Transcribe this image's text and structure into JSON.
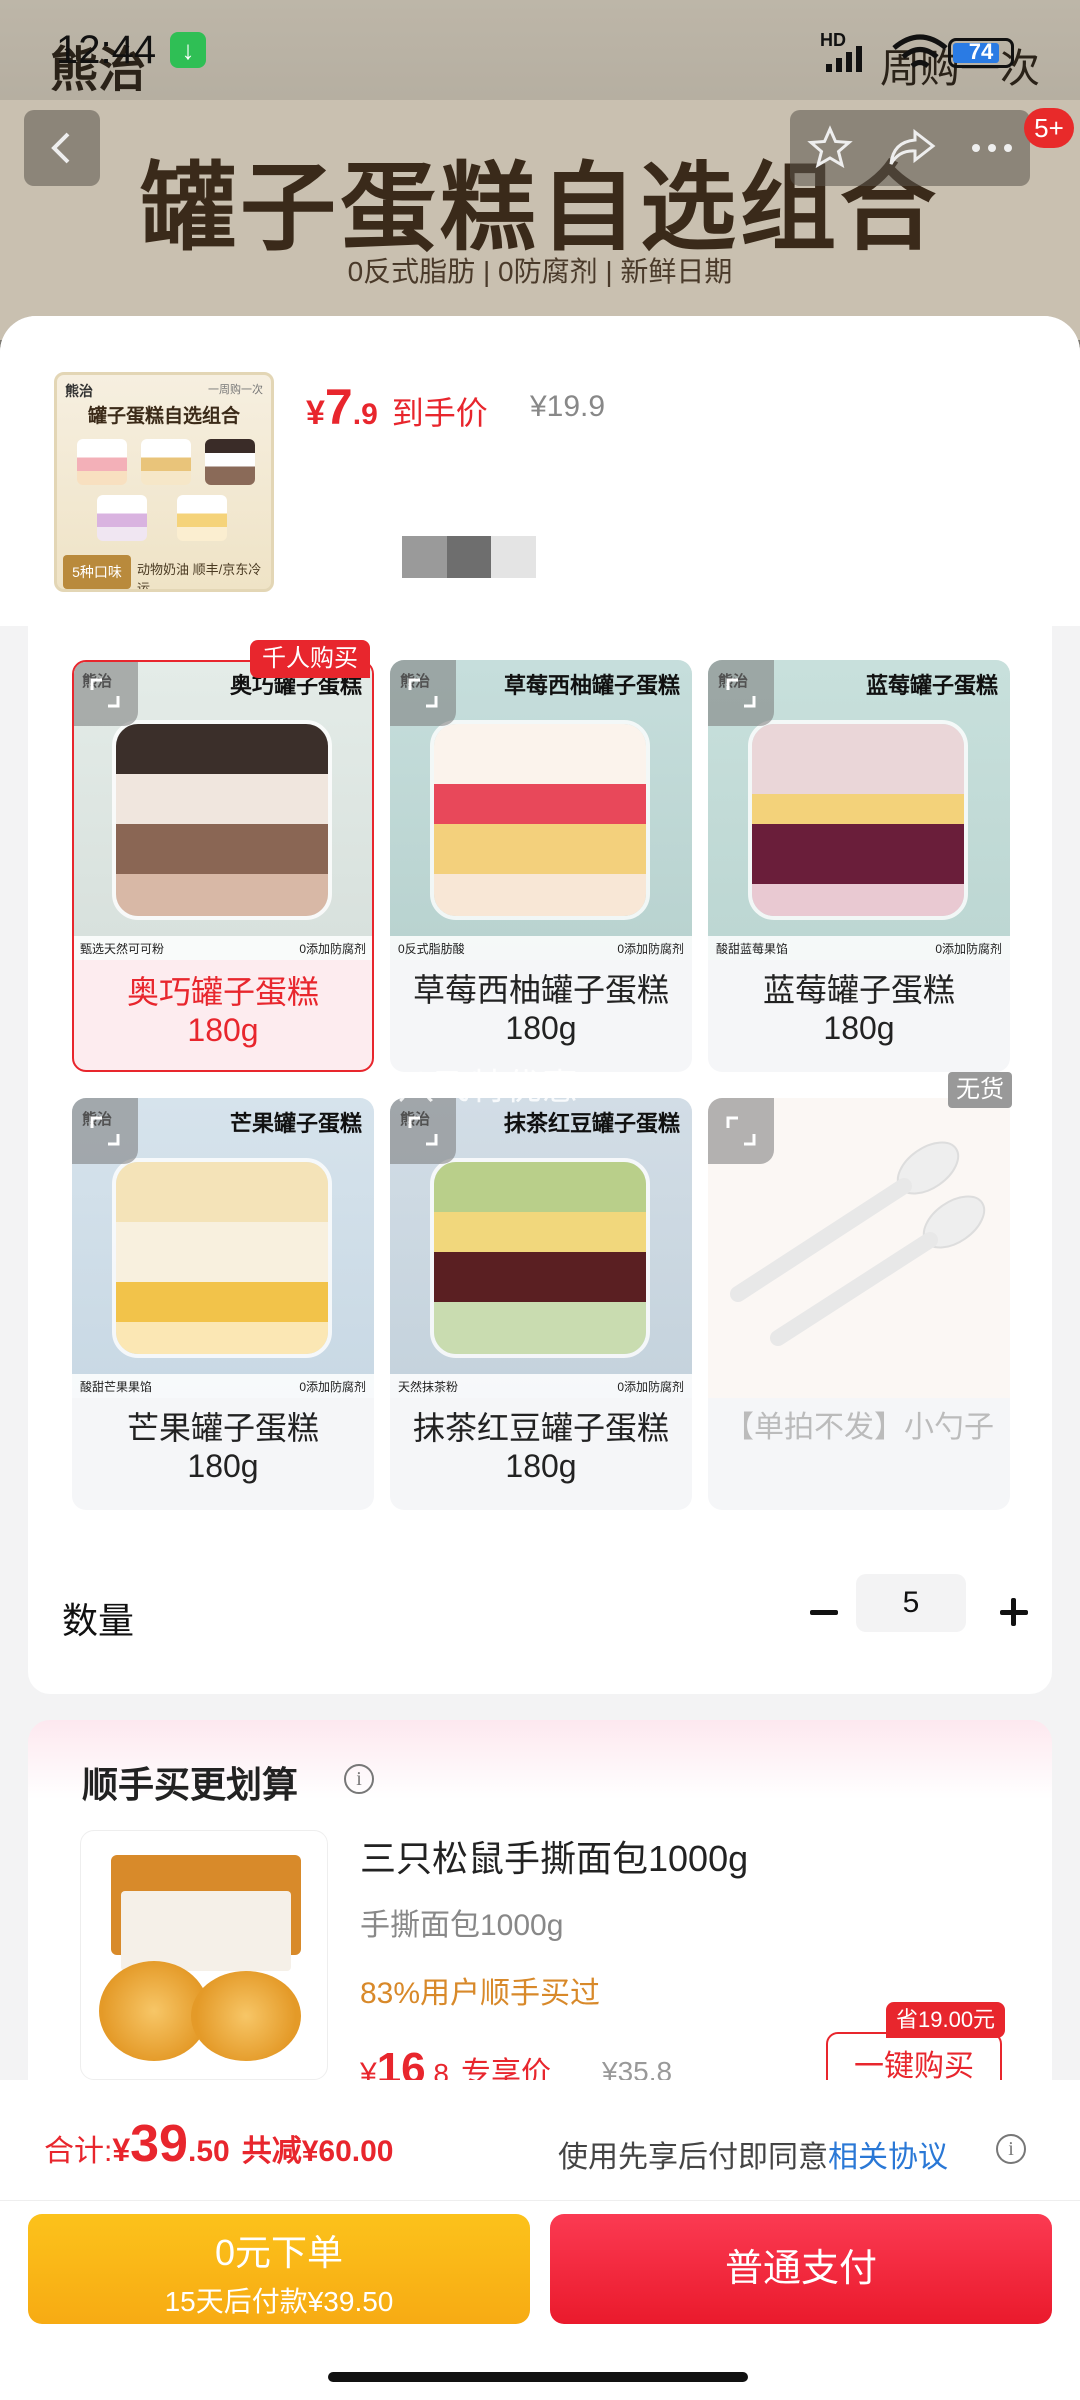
{
  "status_bar": {
    "time": "12:44",
    "hd": "HD",
    "battery": "74"
  },
  "background": {
    "brand": "熊治",
    "right_text": "周购一次",
    "banner_title": "罐子蛋糕自选组合",
    "banner_tags": "0反式脂肪 | 0防腐剂 | 新鲜日期"
  },
  "nav": {
    "badge": "5+"
  },
  "header": {
    "thumb_brand": "熊治",
    "thumb_sub": "一周购一次",
    "thumb_title": "罐子蛋糕自选组合",
    "thumb_foot": "5种口味",
    "thumb_foot2": "动物奶油 顺丰/京东冷运",
    "price_currency": "¥",
    "price_int": "7",
    "price_dec": ".9",
    "price_label": "到手价",
    "price_original": "¥19.9"
  },
  "options": [
    {
      "name": "奥巧罐子蛋糕",
      "spec": "180g",
      "photo_title": "奥巧罐子蛋糕",
      "brand": "熊治",
      "feat_left": "甄选天然可可粉",
      "feat_right": "0添加防腐剂",
      "badge": "千人购买",
      "selected": true
    },
    {
      "name": "草莓西柚罐子蛋糕",
      "spec": "180g",
      "photo_title": "草莓西柚罐子蛋糕",
      "brand": "熊治",
      "feat_left": "0反式脂肪酸",
      "feat_right": "0添加防腐剂"
    },
    {
      "name": "蓝莓罐子蛋糕",
      "spec": "180g",
      "photo_title": "蓝莓罐子蛋糕",
      "brand": "熊治",
      "feat_left": "酸甜蓝莓果馅",
      "feat_right": "0添加防腐剂"
    },
    {
      "name": "芒果罐子蛋糕",
      "spec": "180g",
      "photo_title": "芒果罐子蛋糕",
      "brand": "熊治",
      "feat_left": "酸甜芒果果馅",
      "feat_right": "0添加防腐剂"
    },
    {
      "name": "抹茶红豆罐子蛋糕",
      "spec": "180g",
      "photo_title": "抹茶红豆罐子蛋糕",
      "brand": "熊治",
      "feat_left": "天然抹茶粉",
      "feat_right": "0添加防腐剂"
    },
    {
      "name": "【单拍不发】小勺子",
      "badge": "无货",
      "disabled": true
    }
  ],
  "overlay_promo": "八飞特优惠",
  "quantity": {
    "label": "数量",
    "value": "5"
  },
  "upsell": {
    "title": "顺手买更划算",
    "product_name": "三只松鼠手撕面包1000g",
    "product_sub": "手撕面包1000g",
    "stat": "83%用户顺手买过",
    "price_currency": "¥",
    "price_int": "16",
    "price_dec": ".8",
    "price_label": "专享价",
    "price_original": "¥35.8",
    "button": "一键购买",
    "save_badge": "省19.00元"
  },
  "bottom": {
    "total_label": "合计:",
    "total_currency": "¥",
    "total_int": "39",
    "total_dec": ".50",
    "total_save": "共减¥60.00",
    "agree_text": "使用先享后付即同意",
    "agree_link": "相关协议",
    "later_line1": "0元下单",
    "later_line2": "15天后付款¥39.50",
    "pay_label": "普通支付"
  },
  "colors": {
    "accent_red": "#e8262d",
    "gold": "#f7ab13",
    "link_blue": "#2a78d6"
  }
}
